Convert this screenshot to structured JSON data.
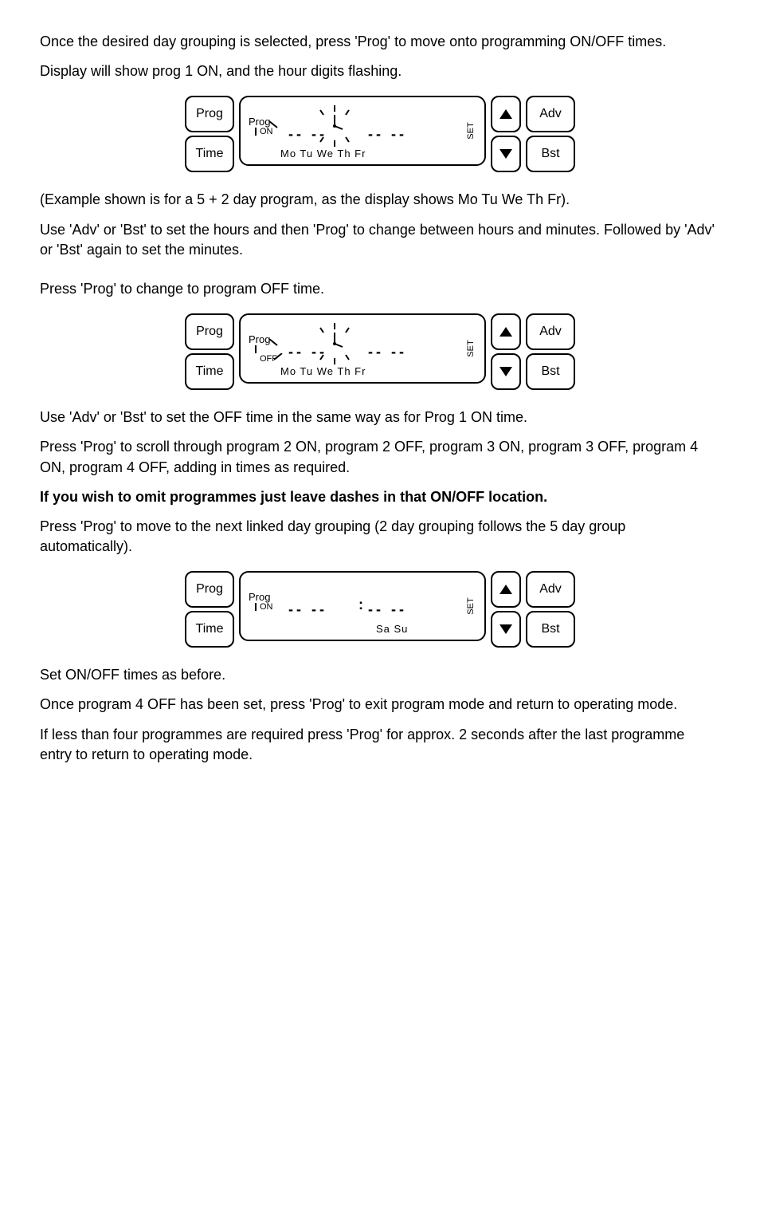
{
  "para1": "Once the desired day grouping is selected, press 'Prog' to move onto programming ON/OFF times.",
  "para2": "Display will show prog 1 ON, and the hour digits flashing.",
  "device1": {
    "btn_prog": "Prog",
    "btn_time": "Time",
    "btn_adv": "Adv",
    "btn_bst": "Bst",
    "lcd_prog": "Prog",
    "lcd_on": "ON",
    "lcd_set": "SET",
    "lcd_days": "Mo Tu We Th Fr"
  },
  "para3": "(Example shown is for a 5 + 2 day program, as the display shows Mo Tu We Th Fr).",
  "para4": "Use 'Adv' or 'Bst' to set the hours and then 'Prog' to change between hours and minutes. Followed by 'Adv' or 'Bst' again to set the minutes.",
  "para5": "Press 'Prog' to change to program OFF time.",
  "device2": {
    "btn_prog": "Prog",
    "btn_time": "Time",
    "btn_adv": "Adv",
    "btn_bst": "Bst",
    "lcd_prog": "Prog",
    "lcd_off": "OFF",
    "lcd_set": "SET",
    "lcd_days": "Mo Tu We Th Fr"
  },
  "para6": "Use 'Adv' or 'Bst' to set the OFF time in the same way as for Prog 1 ON time.",
  "para7": "Press 'Prog' to scroll through program 2 ON, program 2 OFF, program 3 ON, program 3 OFF, program 4 ON, program 4 OFF, adding in times as required.",
  "para8": "If you wish to omit programmes just leave dashes in that ON/OFF location.",
  "para9": "Press 'Prog' to move to the next linked day grouping (2 day grouping follows the 5 day group automatically).",
  "device3": {
    "btn_prog": "Prog",
    "btn_time": "Time",
    "btn_adv": "Adv",
    "btn_bst": "Bst",
    "lcd_prog": "Prog",
    "lcd_on": "ON",
    "lcd_set": "SET",
    "lcd_days": "Sa Su"
  },
  "para10": "Set ON/OFF times as before.",
  "para11": "Once program 4 OFF has been set, press 'Prog' to exit program mode and return to operating mode.",
  "para12": "If less than four programmes are required press 'Prog' for approx. 2 seconds after the last programme entry to return to operating mode."
}
